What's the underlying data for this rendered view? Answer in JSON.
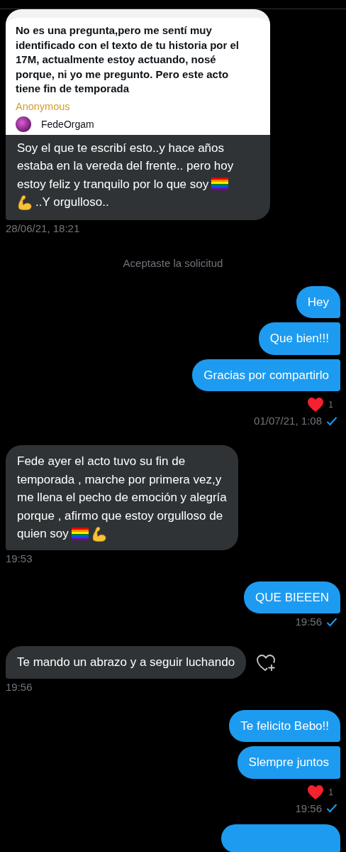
{
  "items": [
    {
      "kind": "received",
      "quote": {
        "question": "No es una pregunta,pero me sentí muy identificado con el texto de tu historia por el 17M, actualmente estoy actuando, nosé porque, ni yo me pregunto. Pero este acto tiene fin de temporada",
        "author": "Anonymous",
        "profile_name": "FedeOrgam"
      },
      "messages": [
        {
          "lines": [
            [
              {
                "kind": "text",
                "text": "Soy el que te escribí esto..y hace años"
              }
            ],
            [
              {
                "kind": "text",
                "text": "estaba en la vereda del frente.. pero hoy"
              }
            ],
            [
              {
                "kind": "text",
                "text": "estoy feliz y tranquilo por lo que soy"
              },
              {
                "kind": "rainbow-flag"
              }
            ],
            [
              {
                "kind": "flexed-arm"
              },
              {
                "kind": "text",
                "text": "..Y orgulloso.."
              }
            ]
          ]
        }
      ],
      "react_button": false,
      "time": "28/06/21, 18:21"
    },
    {
      "kind": "system",
      "text": "Aceptaste la solicitud"
    },
    {
      "kind": "sent",
      "messages": [
        {
          "lines": [
            [
              {
                "kind": "text",
                "text": "Hey"
              }
            ]
          ]
        },
        {
          "lines": [
            [
              {
                "kind": "text",
                "text": "Que bien!!!"
              }
            ]
          ]
        },
        {
          "lines": [
            [
              {
                "kind": "text",
                "text": "Gracias por compartirlo"
              }
            ]
          ]
        }
      ],
      "reactions": {
        "count": "1"
      },
      "time": "01/07/21, 1:08",
      "read": true
    },
    {
      "kind": "received",
      "messages": [
        {
          "lines": [
            [
              {
                "kind": "text",
                "text": "Fede ayer el acto tuvo su fin de"
              }
            ],
            [
              {
                "kind": "text",
                "text": "temporada , marche por primera vez,y"
              }
            ],
            [
              {
                "kind": "text",
                "text": "me llena el pecho de emoción y alegría"
              }
            ],
            [
              {
                "kind": "text",
                "text": "porque , afirmo que estoy orgulloso de"
              }
            ],
            [
              {
                "kind": "text",
                "text": "quien soy"
              },
              {
                "kind": "rainbow-flag"
              },
              {
                "kind": "flexed-arm"
              }
            ]
          ]
        }
      ],
      "react_button": false,
      "time": "19:53"
    },
    {
      "kind": "sent",
      "messages": [
        {
          "lines": [
            [
              {
                "kind": "text",
                "text": "QUE BIEEEN"
              }
            ]
          ]
        }
      ],
      "time": "19:56",
      "read": true
    },
    {
      "kind": "received",
      "messages": [
        {
          "lines": [
            [
              {
                "kind": "text",
                "text": "Te mando un abrazo y a seguir luchando"
              }
            ]
          ]
        }
      ],
      "react_button": true,
      "time": "19:56"
    },
    {
      "kind": "sent",
      "messages": [
        {
          "lines": [
            [
              {
                "kind": "text",
                "text": "Te felicito Bebo!!"
              }
            ]
          ]
        },
        {
          "lines": [
            [
              {
                "kind": "text",
                "text": "Slempre juntos"
              }
            ]
          ]
        }
      ],
      "reactions": {
        "count": "1"
      },
      "time": "19:56",
      "read": true
    },
    {
      "kind": "partial"
    }
  ]
}
